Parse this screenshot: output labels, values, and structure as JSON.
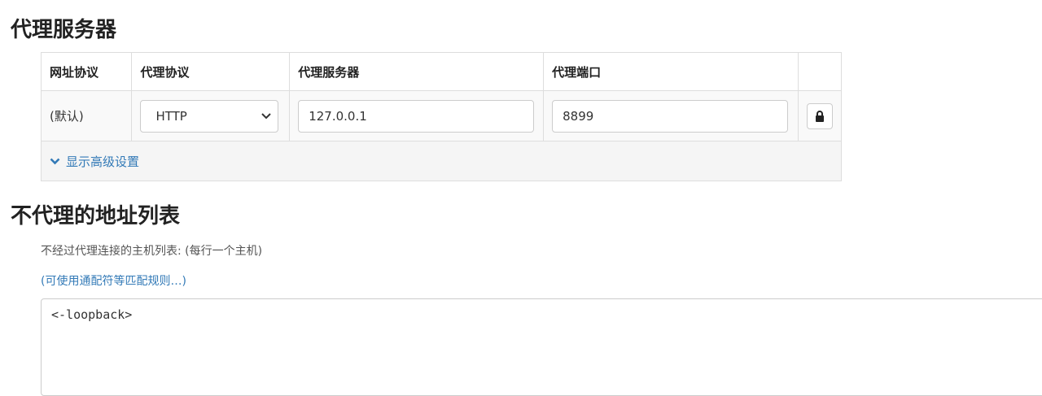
{
  "sections": {
    "proxy_title": "代理服务器",
    "bypass_title": "不代理的地址列表"
  },
  "table": {
    "headers": [
      "网址协议",
      "代理协议",
      "代理服务器",
      "代理端口"
    ],
    "row": {
      "scheme": "(默认)",
      "protocol": "HTTP",
      "server": "127.0.0.1",
      "port": "8899"
    },
    "advanced_label": "显示高级设置"
  },
  "bypass": {
    "description": "不经过代理连接的主机列表: (每行一个主机)",
    "help_link": "(可使用通配符等匹配规则…)",
    "list_value": "<-loopback>"
  },
  "icons": {
    "lock": "lock-icon",
    "chevron": "chevron-down-icon"
  },
  "colors": {
    "link": "#337ab7"
  }
}
